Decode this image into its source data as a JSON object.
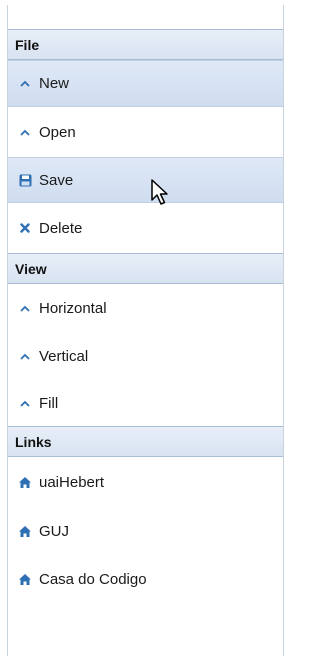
{
  "menu": {
    "sections": [
      {
        "title": "File",
        "items": [
          {
            "label": "New",
            "icon": "chevron-up-icon"
          },
          {
            "label": "Open",
            "icon": "chevron-up-icon"
          },
          {
            "label": "Save",
            "icon": "floppy-disk-icon"
          },
          {
            "label": "Delete",
            "icon": "close-icon"
          }
        ]
      },
      {
        "title": "View",
        "items": [
          {
            "label": "Horizontal",
            "icon": "chevron-up-icon"
          },
          {
            "label": "Vertical",
            "icon": "chevron-up-icon"
          },
          {
            "label": "Fill",
            "icon": "chevron-up-icon"
          }
        ]
      },
      {
        "title": "Links",
        "items": [
          {
            "label": "uaiHebert",
            "icon": "home-icon"
          },
          {
            "label": "GUJ",
            "icon": "home-icon"
          },
          {
            "label": "Casa do Codigo",
            "icon": "home-icon"
          }
        ]
      }
    ]
  },
  "colors": {
    "header_bg": "#dbe5f2",
    "highlight_bg": "#d3e0f2",
    "icon_blue": "#2f6fb3"
  }
}
